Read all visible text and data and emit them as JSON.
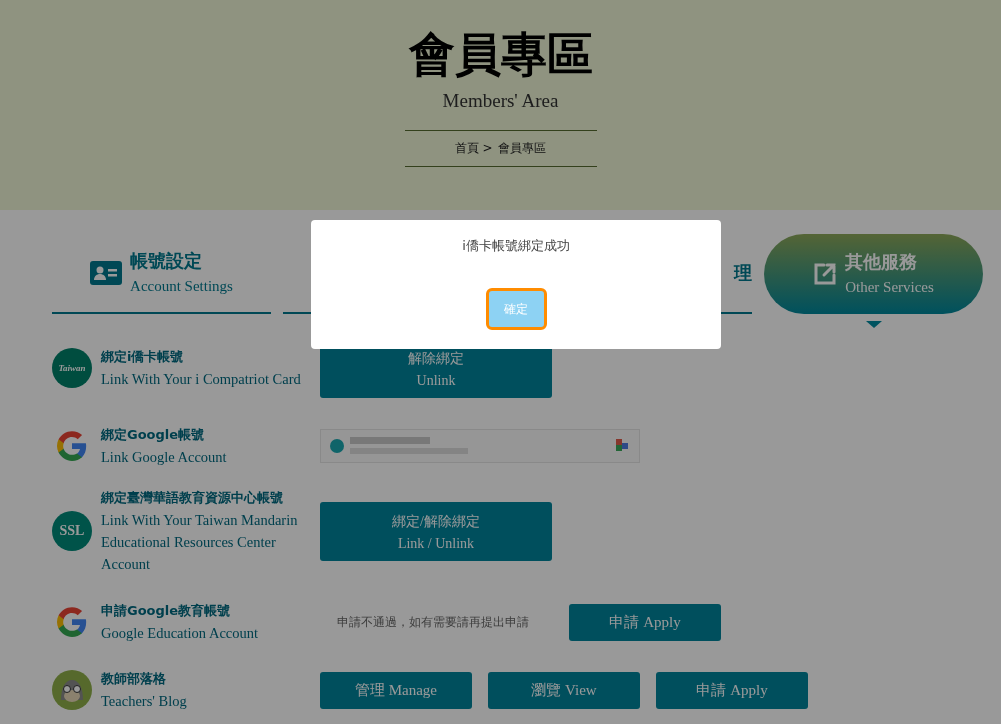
{
  "header": {
    "title": "會員專區",
    "subtitle": "Members' Area",
    "breadcrumb": [
      "首頁 >",
      "會員專區"
    ]
  },
  "tabs": [
    {
      "title": "帳號設定",
      "subtitle": "Account Settings",
      "selected": false
    },
    {
      "selected": false
    },
    {
      "title": "理",
      "selected": false
    },
    {
      "title": "其他服務",
      "subtitle": "Other Services",
      "selected": true
    }
  ],
  "rows": [
    {
      "title": "綁定i僑卡帳號",
      "subtitle": "Link With Your i Compatriot Card",
      "logo": {
        "kind": "taiwan",
        "text": "Taiwan"
      },
      "actions": [
        {
          "kind": "big-button",
          "lines": [
            "解除綁定",
            "Unlink"
          ]
        }
      ]
    },
    {
      "title": "綁定Google帳號",
      "subtitle": "Link Google Account",
      "logo": {
        "kind": "google"
      },
      "actions": [
        {
          "kind": "account"
        }
      ]
    },
    {
      "title": "綁定臺灣華語教育資源中心帳號",
      "subtitle": "Link With Your Taiwan Mandarin Educational Resources Center Account",
      "logo": {
        "kind": "ssl",
        "text": "SSL"
      },
      "actions": [
        {
          "kind": "big-button",
          "lines": [
            "綁定/解除綁定",
            "Link / Unlink"
          ]
        }
      ]
    },
    {
      "title": "申請Google教育帳號",
      "subtitle": "Google Education Account",
      "logo": {
        "kind": "google"
      },
      "actions": [
        {
          "kind": "note",
          "text": "申請不通過，如有需要請再提出申請"
        },
        {
          "kind": "button",
          "label": "申請 Apply"
        }
      ]
    },
    {
      "title": "教師部落格",
      "subtitle": "Teachers' Blog",
      "logo": {
        "kind": "owl"
      },
      "actions": [
        {
          "kind": "button",
          "label": "管理 Manage"
        },
        {
          "kind": "button",
          "label": "瀏覽 View"
        },
        {
          "kind": "button",
          "label": "申請 Apply"
        }
      ]
    }
  ],
  "dialog": {
    "message": "i僑卡帳號綁定成功",
    "button": "確定",
    "focused": true
  }
}
